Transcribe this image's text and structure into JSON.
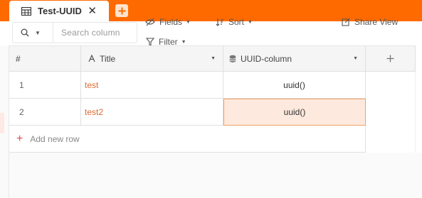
{
  "tab": {
    "label": "Test-UUID",
    "close": "✕",
    "add": "+"
  },
  "toolbar": {
    "search_placeholder": "Search column",
    "fields_label": "Fields",
    "sort_label": "Sort",
    "filter_label": "Filter",
    "share_label": "Share View"
  },
  "table": {
    "columns": [
      {
        "label": "#"
      },
      {
        "label": "Title",
        "icon": "text-type-icon"
      },
      {
        "label": "UUID-column",
        "icon": "database-icon"
      }
    ],
    "add_column": "+",
    "rows": [
      {
        "num": "1",
        "title": "test",
        "uuid": "uuid()"
      },
      {
        "num": "2",
        "title": "test2",
        "uuid": "uuid()"
      }
    ],
    "add_row_label": "Add new row",
    "add_row_plus": "+"
  },
  "colors": {
    "brand": "#ff6a00",
    "link_text": "#e06a2e",
    "selected_cell": "#fde9dd"
  }
}
